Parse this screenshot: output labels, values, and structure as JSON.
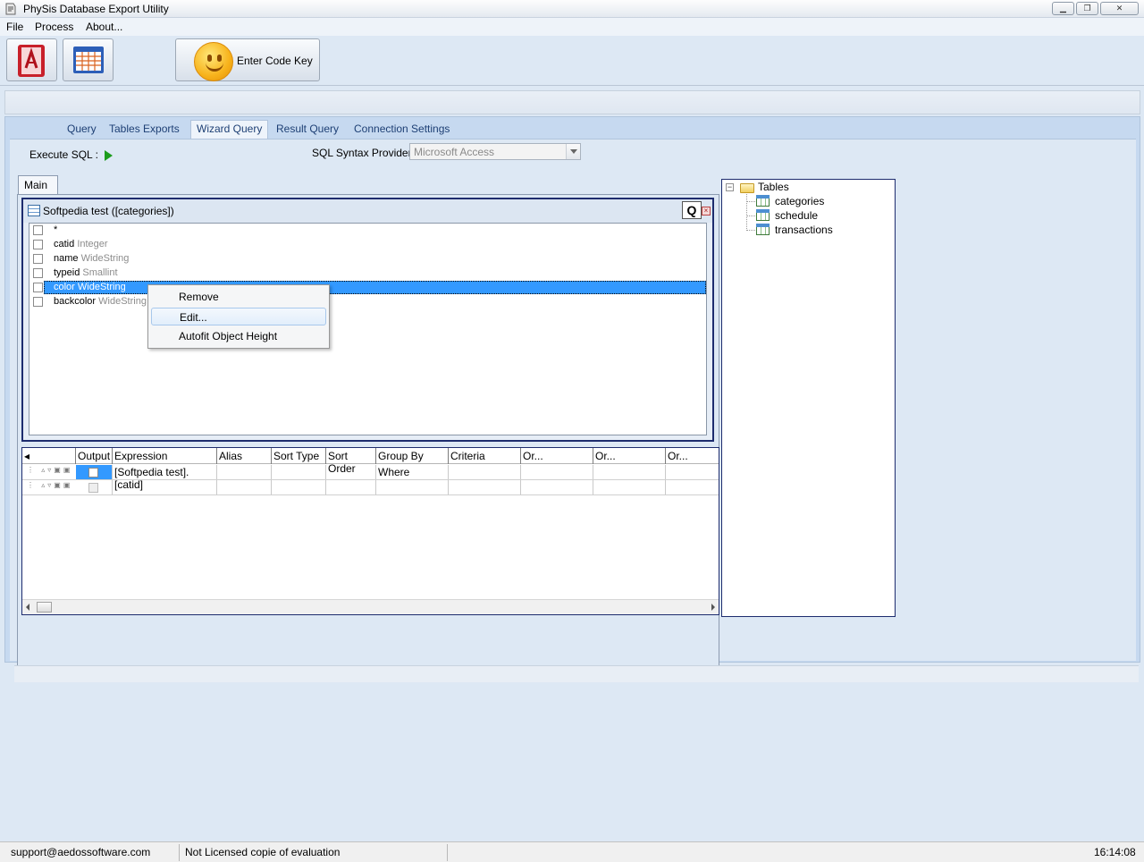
{
  "window": {
    "title": "PhySis Database Export Utility"
  },
  "menu": [
    "File",
    "Process",
    "About..."
  ],
  "toolbar": {
    "code_key_label": "Enter Code Key"
  },
  "tabs": [
    {
      "label": "Query"
    },
    {
      "label": "Tables Exports"
    },
    {
      "label": "Wizard Query",
      "active": true
    },
    {
      "label": "Result Query"
    },
    {
      "label": "Connection Settings"
    }
  ],
  "wizard": {
    "execute_label": "Execute SQL :",
    "syntax_label": "SQL Syntax Provider:",
    "syntax_value": "Microsoft Access",
    "main_tab": "Main"
  },
  "table_window": {
    "title": "Softpedia test ([categories])",
    "q_button": "Q",
    "fields": [
      {
        "name": "*",
        "type": ""
      },
      {
        "name": "catid",
        "type": "Integer"
      },
      {
        "name": "name",
        "type": "WideString"
      },
      {
        "name": "typeid",
        "type": "Smallint"
      },
      {
        "name": "color",
        "type": "WideString",
        "selected": true
      },
      {
        "name": "backcolor",
        "type": "WideString"
      }
    ]
  },
  "context_menu": {
    "items": [
      "Remove",
      "Edit...",
      "Autofit Object Height"
    ],
    "highlighted": "Edit..."
  },
  "grid": {
    "columns": [
      "Output",
      "Expression",
      "Alias",
      "Sort Type",
      "Sort Order",
      "Group By",
      "Criteria",
      "Or...",
      "Or...",
      "Or..."
    ],
    "rows": [
      {
        "expression": "[Softpedia test].[catid]",
        "group_by": "Where"
      },
      {
        "expression": "",
        "group_by": ""
      }
    ]
  },
  "tree": {
    "root": "Tables",
    "children": [
      "categories",
      "schedule",
      "transactions"
    ]
  },
  "status": {
    "email": "support@aedossoftware.com",
    "license": "Not Licensed copie of evaluation",
    "time": "16:14:08"
  }
}
